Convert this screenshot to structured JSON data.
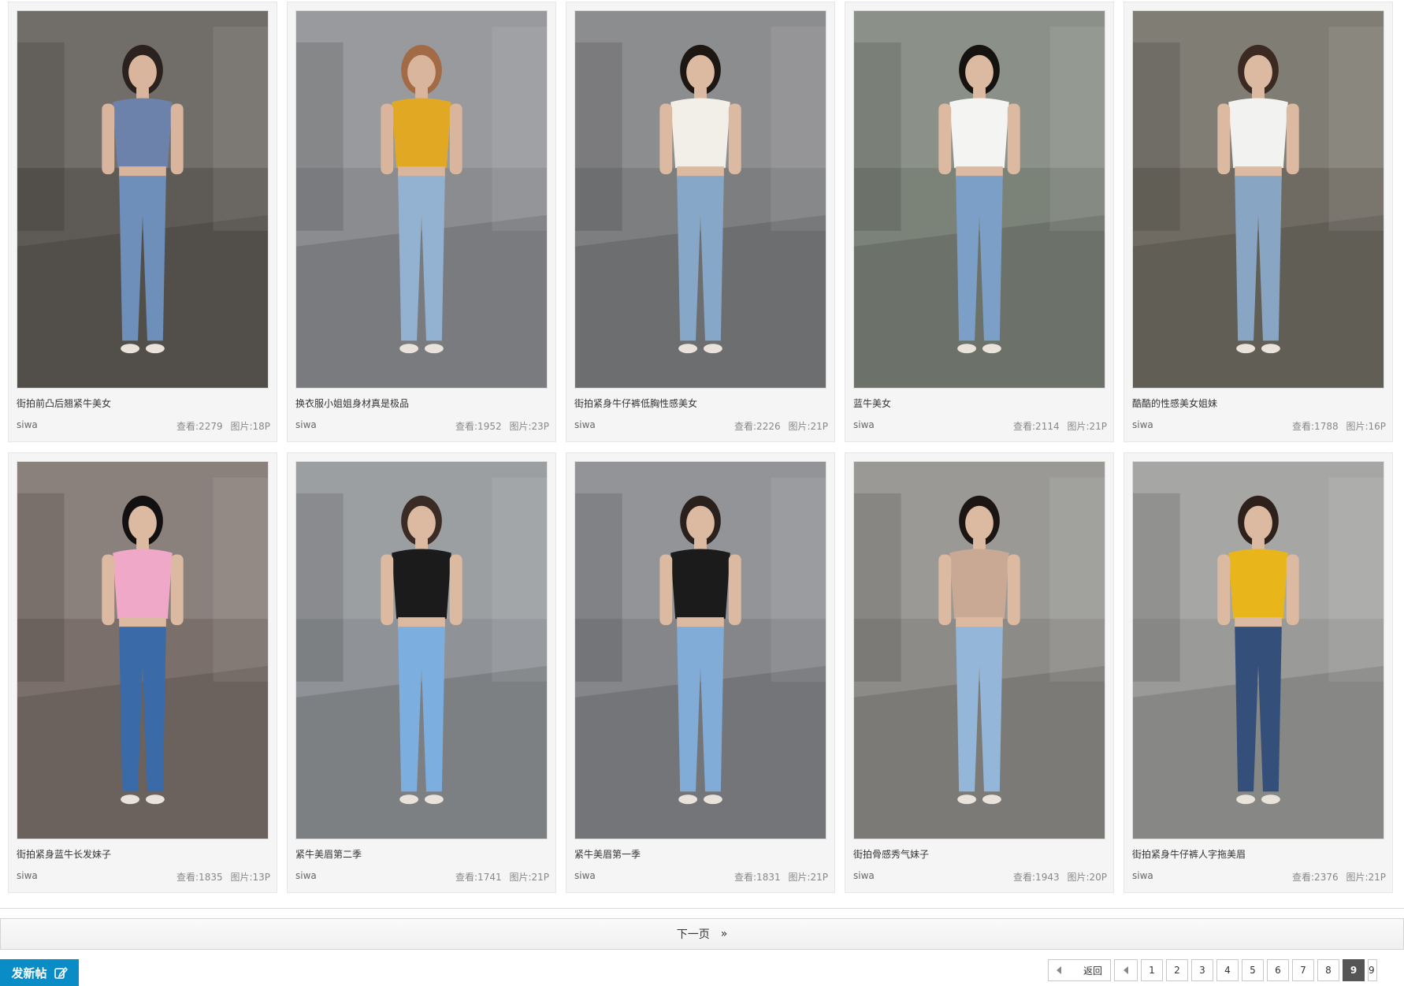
{
  "posts": [
    {
      "title": "街拍前凸后翘紧牛美女",
      "author": "siwa",
      "views": "查看:2279",
      "pics": "图片:18P",
      "colors": {
        "bg": "#5e5a55",
        "top": "#6d82aa",
        "pants": "#6f8fbb",
        "skin": "#d8b59c",
        "hair": "#2b2220"
      }
    },
    {
      "title": "换衣服小姐姐身材真是极品",
      "author": "siwa",
      "views": "查看:1952",
      "pics": "图片:23P",
      "colors": {
        "bg": "#8a8c90",
        "top": "#e0a823",
        "pants": "#93b1d0",
        "skin": "#d8b59c",
        "hair": "#a36b45"
      }
    },
    {
      "title": "街拍紧身牛仔裤低胸性感美女",
      "author": "siwa",
      "views": "查看:2226",
      "pics": "图片:21P",
      "colors": {
        "bg": "#7d7e80",
        "top": "#f1efe8",
        "pants": "#86a7c8",
        "skin": "#dcbaa2",
        "hair": "#1d1714"
      }
    },
    {
      "title": "蓝牛美女",
      "author": "siwa",
      "views": "查看:2114",
      "pics": "图片:21P",
      "colors": {
        "bg": "#7b8278",
        "top": "#f4f4f2",
        "pants": "#7b9fc6",
        "skin": "#dcbaa2",
        "hair": "#151210"
      }
    },
    {
      "title": "酷酷的性感美女姐妹",
      "author": "siwa",
      "views": "查看:1788",
      "pics": "图片:16P",
      "colors": {
        "bg": "#6f6b62",
        "top": "#f2f2f0",
        "pants": "#88a5c3",
        "skin": "#dcbaa2",
        "hair": "#3b2a22"
      }
    },
    {
      "title": "街拍紧身蓝牛长发妹子",
      "author": "siwa",
      "views": "查看:1835",
      "pics": "图片:13P",
      "colors": {
        "bg": "#7a6f6a",
        "top": "#f0a8c8",
        "pants": "#3a6aa8",
        "skin": "#dcbaa2",
        "hair": "#121010"
      }
    },
    {
      "title": "紧牛美眉第二季",
      "author": "siwa",
      "views": "查看:1741",
      "pics": "图片:21P",
      "colors": {
        "bg": "#8f9296",
        "top": "#1b1b1b",
        "pants": "#7daee0",
        "skin": "#dcbaa2",
        "hair": "#3a2b24"
      }
    },
    {
      "title": "紧牛美眉第一季",
      "author": "siwa",
      "views": "查看:1831",
      "pics": "图片:21P",
      "colors": {
        "bg": "#84868a",
        "top": "#1b1b1b",
        "pants": "#82acd8",
        "skin": "#dcbaa2",
        "hair": "#2a211c"
      }
    },
    {
      "title": "街拍骨感秀气妹子",
      "author": "siwa",
      "views": "查看:1943",
      "pics": "图片:20P",
      "colors": {
        "bg": "#8c8b88",
        "top": "#c9a994",
        "pants": "#93b6d9",
        "skin": "#dcbaa2",
        "hair": "#1b1513"
      }
    },
    {
      "title": "街拍紧身牛仔裤人字拖美眉",
      "author": "siwa",
      "views": "查看:2376",
      "pics": "图片:21P",
      "colors": {
        "bg": "#9a9a98",
        "top": "#e8b51a",
        "pants": "#34507a",
        "skin": "#dcbaa2",
        "hair": "#2e211b"
      }
    }
  ],
  "next_page": {
    "label": "下一页",
    "arrow": "»"
  },
  "new_post": {
    "label": "发新帖",
    "icon": "edit-icon"
  },
  "pagination": {
    "back_label": "返回",
    "pages": [
      "1",
      "2",
      "3",
      "4",
      "5",
      "6",
      "7",
      "8"
    ],
    "current": "9",
    "partial": "9"
  }
}
